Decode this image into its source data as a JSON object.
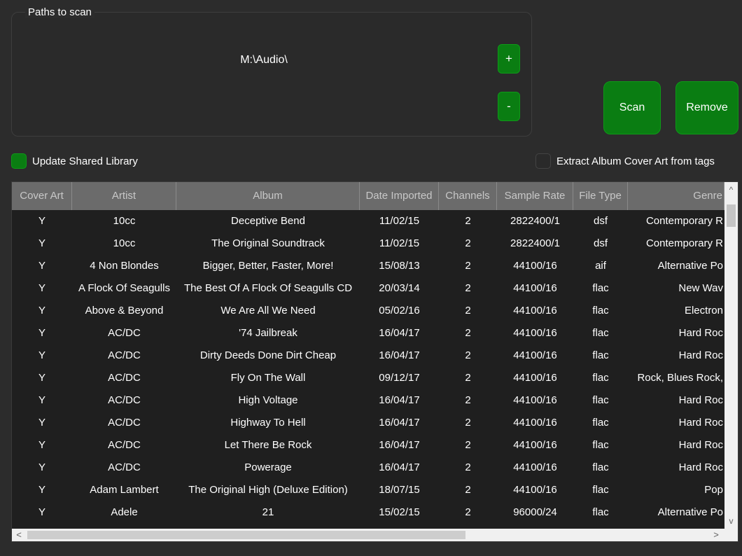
{
  "paths_group": {
    "title": "Paths to scan",
    "paths": [
      "M:\\Audio\\"
    ],
    "add_label": "+",
    "remove_label": "-"
  },
  "buttons": {
    "scan": "Scan",
    "remove": "Remove"
  },
  "checkboxes": {
    "update_shared": {
      "label": "Update Shared Library",
      "checked": true
    },
    "extract_art": {
      "label": "Extract Album Cover Art from tags",
      "checked": false
    }
  },
  "table": {
    "columns": [
      "Cover Art",
      "Artist",
      "Album",
      "Date Imported",
      "Channels",
      "Sample Rate",
      "File Type",
      "Genre"
    ],
    "rows": [
      [
        "Y",
        "10cc",
        "Deceptive Bend",
        "11/02/15",
        "2",
        "2822400/1",
        "dsf",
        "Contemporary R"
      ],
      [
        "Y",
        "10cc",
        "The Original Soundtrack",
        "11/02/15",
        "2",
        "2822400/1",
        "dsf",
        "Contemporary R"
      ],
      [
        "Y",
        "4 Non Blondes",
        "Bigger, Better, Faster, More!",
        "15/08/13",
        "2",
        "44100/16",
        "aif",
        "Alternative Po"
      ],
      [
        "Y",
        "A Flock Of Seagulls",
        "The Best Of A Flock Of Seagulls CD",
        "20/03/14",
        "2",
        "44100/16",
        "flac",
        "New Wav"
      ],
      [
        "Y",
        "Above & Beyond",
        "We Are All We Need",
        "05/02/16",
        "2",
        "44100/16",
        "flac",
        "Electron"
      ],
      [
        "Y",
        "AC/DC",
        "'74 Jailbreak",
        "16/04/17",
        "2",
        "44100/16",
        "flac",
        "Hard Roc"
      ],
      [
        "Y",
        "AC/DC",
        "Dirty Deeds Done Dirt Cheap",
        "16/04/17",
        "2",
        "44100/16",
        "flac",
        "Hard Roc"
      ],
      [
        "Y",
        "AC/DC",
        "Fly On The Wall",
        "09/12/17",
        "2",
        "44100/16",
        "flac",
        "Rock, Blues Rock,"
      ],
      [
        "Y",
        "AC/DC",
        "High Voltage",
        "16/04/17",
        "2",
        "44100/16",
        "flac",
        "Hard Roc"
      ],
      [
        "Y",
        "AC/DC",
        "Highway To Hell",
        "16/04/17",
        "2",
        "44100/16",
        "flac",
        "Hard Roc"
      ],
      [
        "Y",
        "AC/DC",
        "Let There Be Rock",
        "16/04/17",
        "2",
        "44100/16",
        "flac",
        "Hard Roc"
      ],
      [
        "Y",
        "AC/DC",
        "Powerage",
        "16/04/17",
        "2",
        "44100/16",
        "flac",
        "Hard Roc"
      ],
      [
        "Y",
        "Adam Lambert",
        "The Original High (Deluxe Edition)",
        "18/07/15",
        "2",
        "44100/16",
        "flac",
        "Pop"
      ],
      [
        "Y",
        "Adele",
        "21",
        "15/02/15",
        "2",
        "96000/24",
        "flac",
        "Alternative Po"
      ]
    ]
  },
  "scrollbars": {
    "up": "^",
    "down": "v",
    "left": "<",
    "right": ">"
  },
  "colors": {
    "accent": "#0a7d12",
    "background": "#2c2c2c",
    "header": "#6b6b6b"
  }
}
